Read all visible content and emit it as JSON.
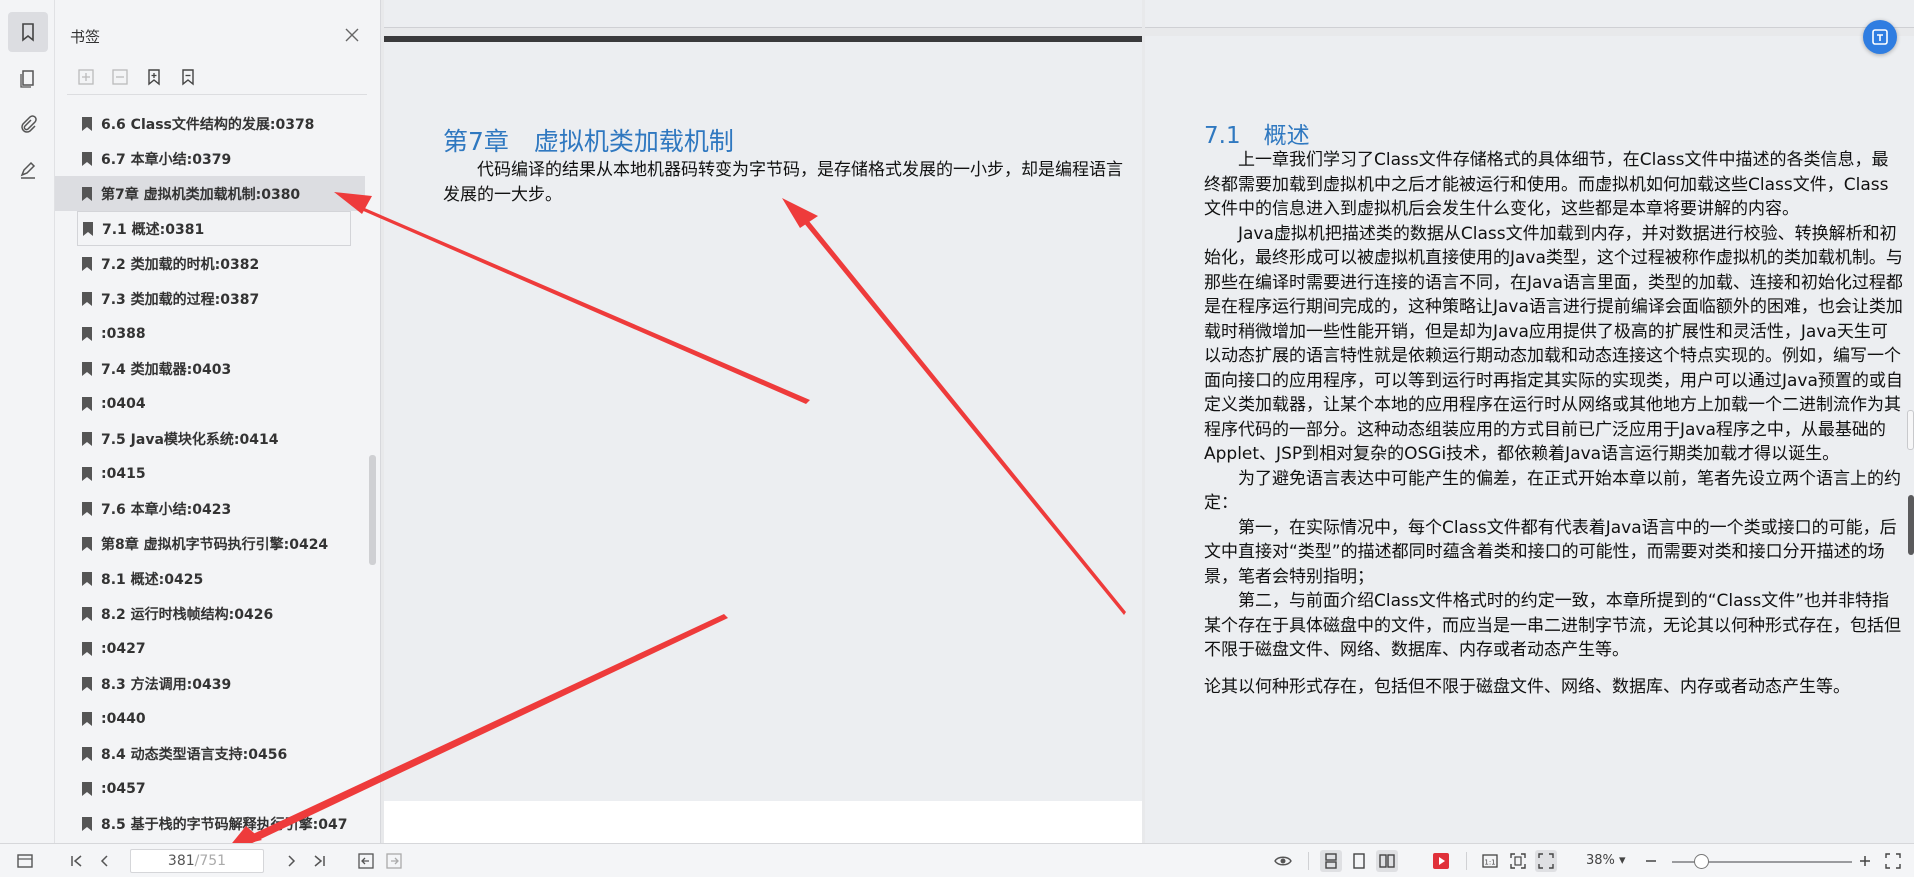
{
  "bookmark_panel": {
    "title": "书签",
    "items": [
      {
        "label": "6.6 Class文件结构的发展:0378"
      },
      {
        "label": "6.7 本章小结:0379"
      },
      {
        "label": "第7章 虚拟机类加载机制:0380"
      },
      {
        "label": "7.1 概述:0381"
      },
      {
        "label": "7.2 类加载的时机:0382"
      },
      {
        "label": "7.3 类加载的过程:0387"
      },
      {
        "label": ":0388"
      },
      {
        "label": "7.4 类加载器:0403"
      },
      {
        "label": ":0404"
      },
      {
        "label": "7.5 Java模块化系统:0414"
      },
      {
        "label": ":0415"
      },
      {
        "label": "7.6 本章小结:0423"
      },
      {
        "label": "第8章 虚拟机字节码执行引擎:0424"
      },
      {
        "label": "8.1 概述:0425"
      },
      {
        "label": "8.2 运行时栈帧结构:0426"
      },
      {
        "label": ":0427"
      },
      {
        "label": "8.3 方法调用:0439"
      },
      {
        "label": ":0440"
      },
      {
        "label": "8.4 动态类型语言支持:0456"
      },
      {
        "label": ":0457"
      },
      {
        "label": "8.5 基于栈的字节码解释执行引擎:047"
      }
    ]
  },
  "left_page": {
    "chapter_title": "第7章　虚拟机类加载机制",
    "lead": "代码编译的结果从本地机器码转变为字节码，是存储格式发展的一小步，却是编程语言发展的一大步。"
  },
  "right_page": {
    "section_title": "7.1　概述",
    "paragraphs": [
      "上一章我们学习了Class文件存储格式的具体细节，在Class文件中描述的各类信息，最终都需要加载到虚拟机中之后才能被运行和使用。而虚拟机如何加载这些Class文件，Class文件中的信息进入到虚拟机后会发生什么变化，这些都是本章将要讲解的内容。",
      "Java虚拟机把描述类的数据从Class文件加载到内存，并对数据进行校验、转换解析和初始化，最终形成可以被虚拟机直接使用的Java类型，这个过程被称作虚拟机的类加载机制。与那些在编译时需要进行连接的语言不同，在Java语言里面，类型的加载、连接和初始化过程都是在程序运行期间完成的，这种策略让Java语言进行提前编译会面临额外的困难，也会让类加载时稍微增加一些性能开销，但是却为Java应用提供了极高的扩展性和灵活性，Java天生可以动态扩展的语言特性就是依赖运行期动态加载和动态连接这个特点实现的。例如，编写一个面向接口的应用程序，可以等到运行时再指定其实际的实现类，用户可以通过Java预置的或自定义类加载器，让某个本地的应用程序在运行时从网络或其他地方上加载一个二进制流作为其程序代码的一部分。这种动态组装应用的方式目前已广泛应用于Java程序之中，从最基础的Applet、JSP到相对复杂的OSGi技术，都依赖着Java语言运行期类加载才得以诞生。",
      "为了避免语言表达中可能产生的偏差，在正式开始本章以前，笔者先设立两个语言上的约定：",
      "第一，在实际情况中，每个Class文件都有代表着Java语言中的一个类或接口的可能，后文中直接对“类型”的描述都同时蕴含着类和接口的可能性，而需要对类和接口分开描述的场景，笔者会特别指明；",
      "第二，与前面介绍Class文件格式时的约定一致，本章所提到的“Class文件”也并非特指某个存在于具体磁盘中的文件，而应当是一串二进制字节流，无论其以何种形式存在，包括但不限于磁盘文件、网络、数据库、内存或者动态产生等。"
    ],
    "extra": "论其以何种形式存在，包括但不限于磁盘文件、网络、数据库、内存或者动态产生等。"
  },
  "status_bar": {
    "current_page": "381",
    "total_pages": "/751",
    "zoom": "38%"
  },
  "colors": {
    "accent": "#2f78c0",
    "annotation_arrow": "#ee3b3b",
    "play_button": "#e0313a"
  }
}
